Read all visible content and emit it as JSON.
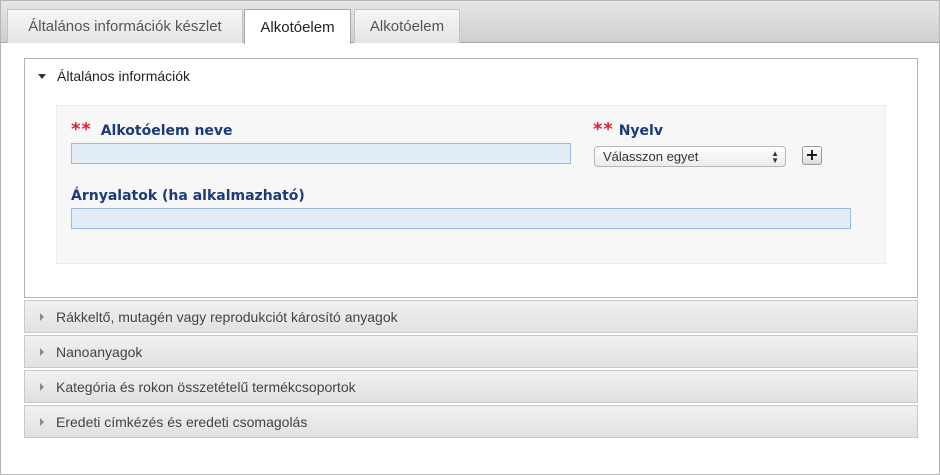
{
  "tabs": [
    {
      "label": "Általános információk készlet",
      "active": false
    },
    {
      "label": "Alkotóelem",
      "active": true
    },
    {
      "label": "Alkotóelem",
      "active": false
    }
  ],
  "general_section": {
    "title": "Általános információk",
    "required_marker": "**",
    "component_name_label": "Alkotóelem neve",
    "component_name_value": "",
    "language_label": "Nyelv",
    "language_select_value": "Válasszon egyet",
    "add_button_label": "+",
    "shades_label": "Árnyalatok (ha alkalmazható)",
    "shades_value": ""
  },
  "collapsed_sections": [
    {
      "title": "Rákkeltő, mutagén vagy reprodukciót károsító anyagok"
    },
    {
      "title": "Nanoanyagok"
    },
    {
      "title": "Kategória és rokon összetételű termékcsoportok"
    },
    {
      "title": "Eredeti címkézés és eredeti csomagolás"
    }
  ],
  "colors": {
    "label_blue": "#1a3a7a",
    "required_red": "#e0203a",
    "input_fill": "#e3edf8"
  }
}
